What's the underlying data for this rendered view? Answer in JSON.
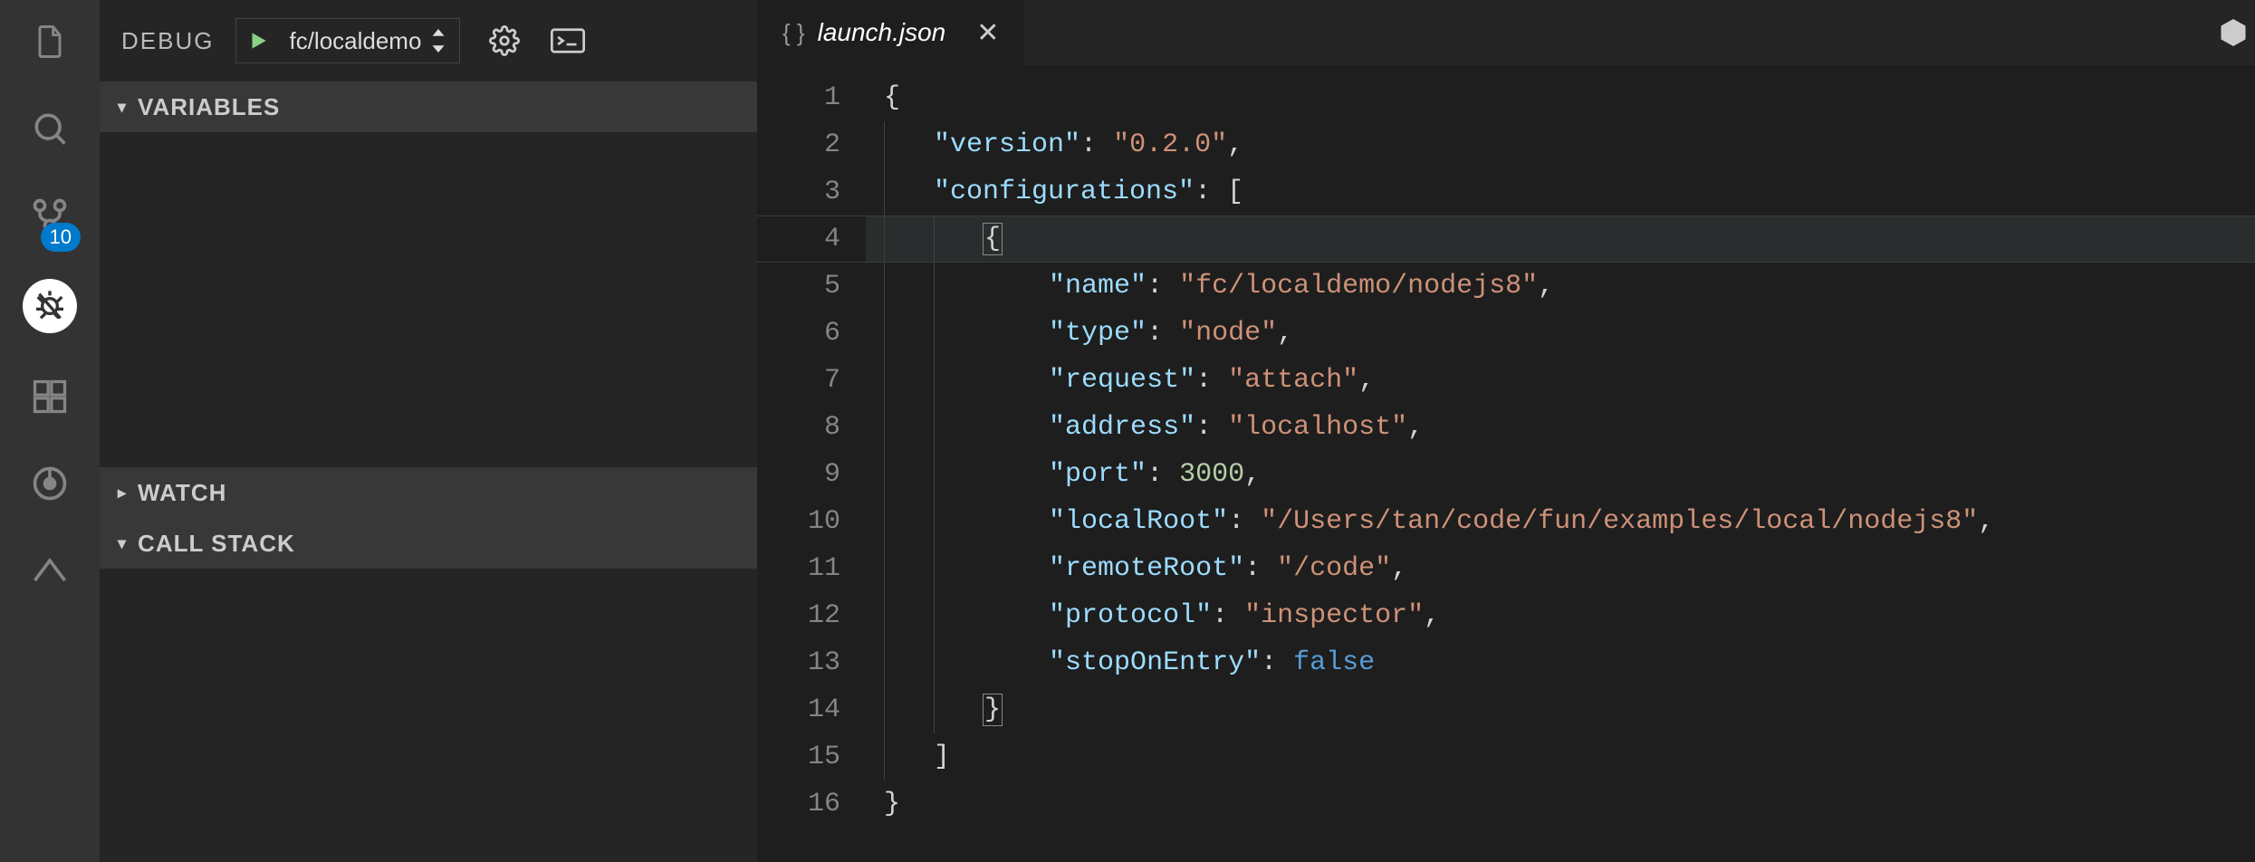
{
  "activity_bar": {
    "scm_badge": "10"
  },
  "debug_panel": {
    "title": "DEBUG",
    "config_name": "fc/localdemo",
    "sections": {
      "variables": "VARIABLES",
      "watch": "WATCH",
      "call_stack": "CALL STACK"
    }
  },
  "tab": {
    "filename": "launch.json",
    "icon": "{ }"
  },
  "editor": {
    "line_numbers": [
      "1",
      "2",
      "3",
      "4",
      "5",
      "6",
      "7",
      "8",
      "9",
      "10",
      "11",
      "12",
      "13",
      "14",
      "15",
      "16"
    ],
    "current_line": 4,
    "json_content": {
      "version": "0.2.0",
      "configurations": [
        {
          "name": "fc/localdemo/nodejs8",
          "type": "node",
          "request": "attach",
          "address": "localhost",
          "port": 3000,
          "localRoot": "/Users/tan/code/fun/examples/local/nodejs8",
          "remoteRoot": "/code",
          "protocol": "inspector",
          "stopOnEntry": false
        }
      ]
    },
    "tokens": {
      "l2_k": "\"version\"",
      "l2_v": "\"0.2.0\"",
      "l3_k": "\"configurations\"",
      "l5_k": "\"name\"",
      "l5_v": "\"fc/localdemo/nodejs8\"",
      "l6_k": "\"type\"",
      "l6_v": "\"node\"",
      "l7_k": "\"request\"",
      "l7_v": "\"attach\"",
      "l8_k": "\"address\"",
      "l8_v": "\"localhost\"",
      "l9_k": "\"port\"",
      "l9_v": "3000",
      "l10_k": "\"localRoot\"",
      "l10_v": "\"/Users/tan/code/fun/examples/local/nodejs8\"",
      "l11_k": "\"remoteRoot\"",
      "l11_v": "\"/code\"",
      "l12_k": "\"protocol\"",
      "l12_v": "\"inspector\"",
      "l13_k": "\"stopOnEntry\"",
      "l13_v": "false"
    }
  }
}
